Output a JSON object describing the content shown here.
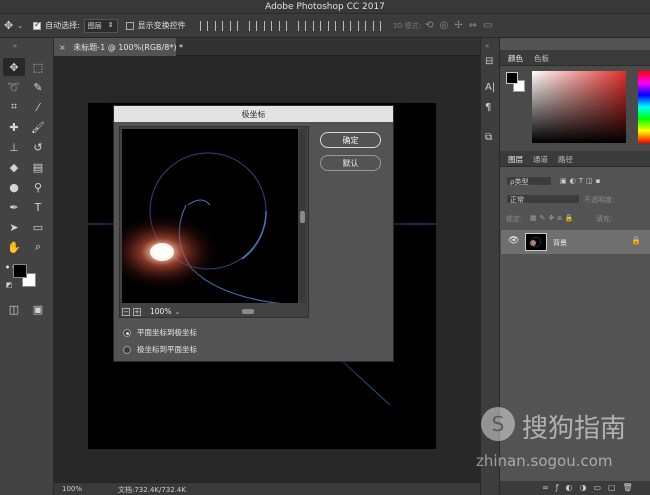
{
  "app": {
    "title": "Adobe Photoshop CC 2017"
  },
  "options_bar": {
    "move_icon": "move-icon",
    "auto_select_label": "自动选择:",
    "auto_select_value": "图层",
    "show_transform_label": "显示变换控件",
    "mode_3d_label": "3D 模式:"
  },
  "document": {
    "tab_title": "未标题-1 @ 100%(RGB/8*) *",
    "close_glyph": "×"
  },
  "status_bar": {
    "zoom": "100%",
    "doc_size": "文档:732.4K/732.4K"
  },
  "polar_dialog": {
    "title": "极坐标",
    "ok_label": "确定",
    "default_label": "默认",
    "zoom_value": "100%",
    "zoom_out_glyph": "−",
    "zoom_in_glyph": "+",
    "options": [
      {
        "label": "平面坐标到极坐标",
        "selected": true
      },
      {
        "label": "极坐标到平面坐标",
        "selected": false
      }
    ]
  },
  "color_panel": {
    "tabs": [
      "颜色",
      "色板"
    ],
    "active_tab": 0,
    "accent": "#e0302a"
  },
  "layers_panel": {
    "tabs": [
      "图层",
      "通道",
      "路径"
    ],
    "filter_label": "ρ类型",
    "blend_mode": "正常",
    "opacity_label": "不透明度:",
    "lock_label": "锁定:",
    "fill_label": "填充:",
    "layers": [
      {
        "name": "背景",
        "visible": true,
        "locked": true
      }
    ]
  },
  "watermark": {
    "brand_text": "搜狗指南",
    "url_text": "zhinan.sogou.com"
  }
}
